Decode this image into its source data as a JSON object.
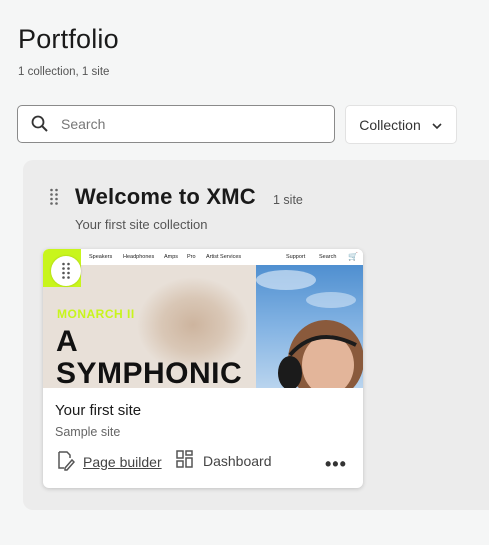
{
  "header": {
    "title": "Portfolio",
    "subtitle": "1 collection, 1 site"
  },
  "search": {
    "placeholder": "Search",
    "value": ""
  },
  "filter": {
    "label": "Collection"
  },
  "collection": {
    "title": "Welcome to XMC",
    "count": "1 site",
    "description": "Your first site collection"
  },
  "site_card": {
    "name": "Your first site",
    "type": "Sample site",
    "page_builder_label": "Page builder",
    "dashboard_label": "Dashboard",
    "more_label": "•••",
    "thumbnail": {
      "nav_items": [
        "Speakers",
        "Headphones",
        "Amps",
        "Pro",
        "Artist Services"
      ],
      "nav_right": [
        "Support",
        "Search"
      ],
      "brand_text": "MONARCH II",
      "hero_line1": "A",
      "hero_line2": "SYMPHONIC"
    }
  },
  "colors": {
    "accent_lime": "#c8f51c",
    "background": "#f5f6f6",
    "group_background": "#ececec"
  }
}
